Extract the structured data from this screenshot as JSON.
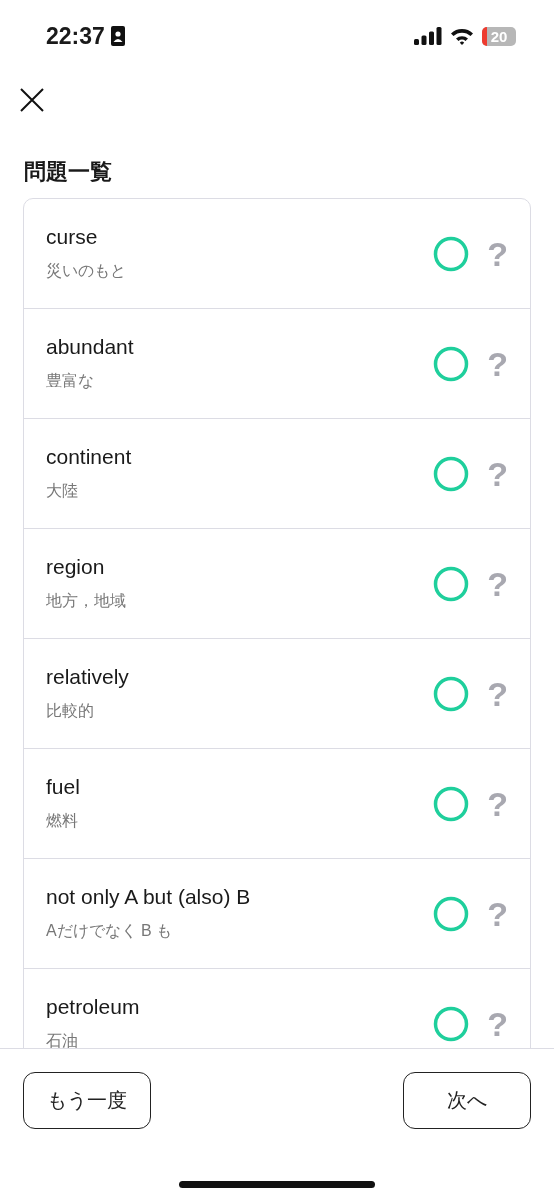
{
  "status_bar": {
    "time": "22:37",
    "battery": "20"
  },
  "title": "問題一覧",
  "questions": [
    {
      "word": "curse",
      "meaning": "災いのもと",
      "correct": true,
      "hint": "?"
    },
    {
      "word": "abundant",
      "meaning": "豊富な",
      "correct": true,
      "hint": "?"
    },
    {
      "word": "continent",
      "meaning": "大陸",
      "correct": true,
      "hint": "?"
    },
    {
      "word": "region",
      "meaning": "地方，地域",
      "correct": true,
      "hint": "?"
    },
    {
      "word": "relatively",
      "meaning": "比較的",
      "correct": true,
      "hint": "?"
    },
    {
      "word": "fuel",
      "meaning": "燃料",
      "correct": true,
      "hint": "?"
    },
    {
      "word": "not only A but (also) B",
      "meaning": "Aだけでなく B も",
      "correct": true,
      "hint": "?"
    },
    {
      "word": "petroleum",
      "meaning": "石油",
      "correct": true,
      "hint": "?"
    }
  ],
  "buttons": [
    "もう一度",
    "次へ"
  ]
}
